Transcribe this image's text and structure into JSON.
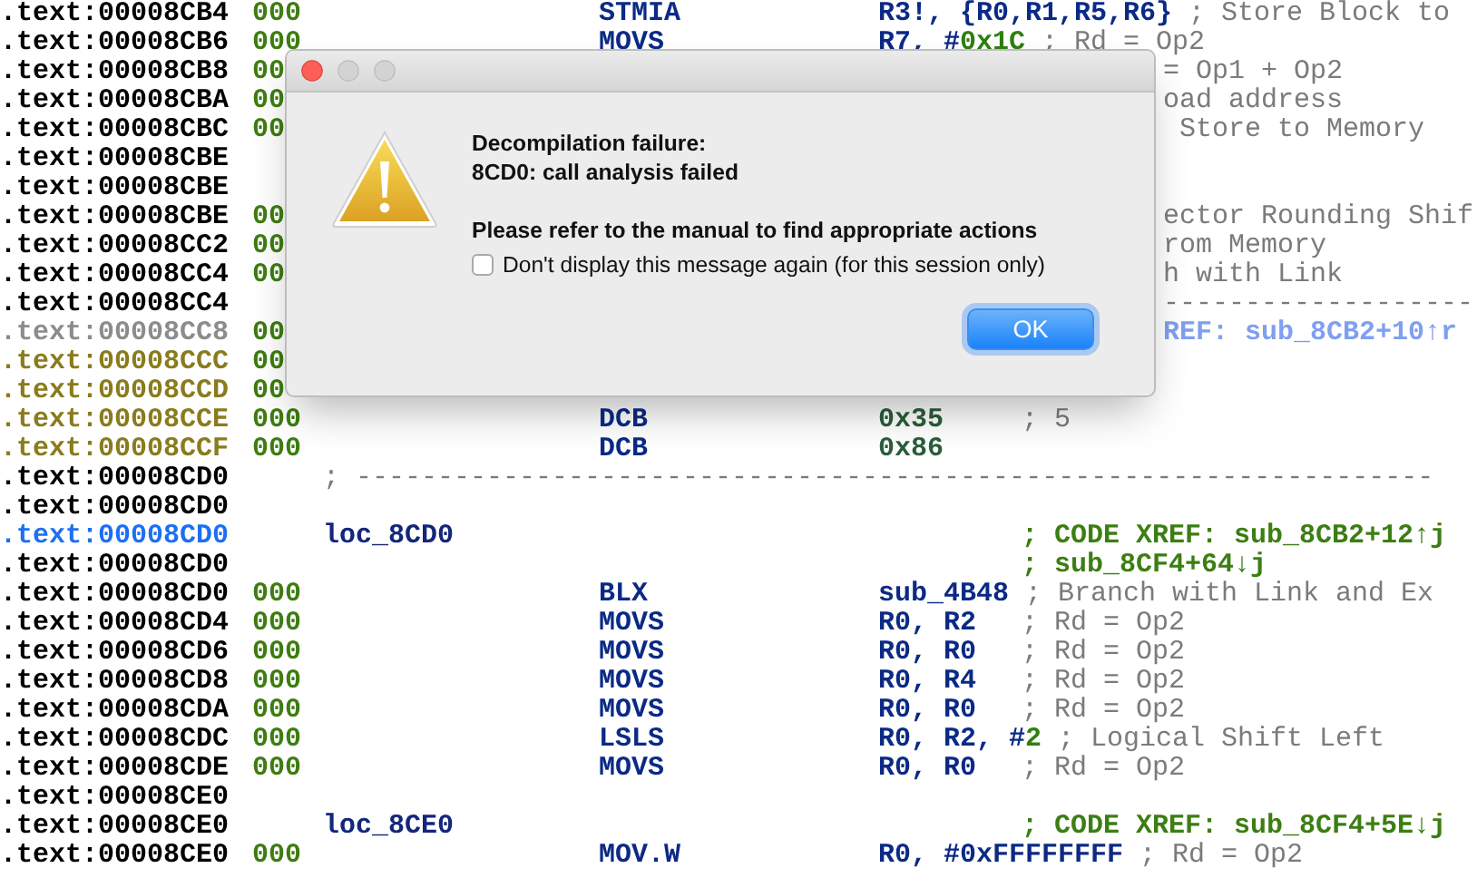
{
  "listing": {
    "rows": [
      {
        "address": {
          "text": ".text:00008CB4",
          "kind": "plain"
        },
        "bytes": "000",
        "mnemonic": "STMIA",
        "operands": [
          {
            "text": "R3!, {R0,R1,R5,R6}",
            "kind": "reg"
          }
        ],
        "comment": {
          "text": "; Store Block to",
          "kind": "note"
        }
      },
      {
        "address": {
          "text": ".text:00008CB6",
          "kind": "plain"
        },
        "bytes": "000",
        "mnemonic": "MOVS",
        "operands": [
          {
            "text": "R7, #",
            "kind": "reg"
          },
          {
            "text": "0x1C",
            "kind": "num"
          }
        ],
        "comment": {
          "text": "; Rd = Op2",
          "kind": "note"
        }
      },
      {
        "address": {
          "text": ".text:00008CB8",
          "kind": "plain"
        },
        "bytes": "00",
        "tail": {
          "text": "= Op1 + Op2",
          "kind": "note"
        }
      },
      {
        "address": {
          "text": ".text:00008CBA",
          "kind": "plain"
        },
        "bytes": "00",
        "tail": {
          "text": "oad address",
          "kind": "note"
        }
      },
      {
        "address": {
          "text": ".text:00008CBC",
          "kind": "plain"
        },
        "bytes": "00",
        "tail": {
          "text": " Store to Memory",
          "kind": "note"
        }
      },
      {
        "address": {
          "text": ".text:00008CBE",
          "kind": "plain"
        }
      },
      {
        "address": {
          "text": ".text:00008CBE",
          "kind": "plain"
        }
      },
      {
        "address": {
          "text": ".text:00008CBE",
          "kind": "plain"
        },
        "bytes": "00",
        "tail": {
          "text": "ector Rounding Shif",
          "kind": "note"
        }
      },
      {
        "address": {
          "text": ".text:00008CC2",
          "kind": "plain"
        },
        "bytes": "00",
        "tail": {
          "text": "rom Memory",
          "kind": "note"
        }
      },
      {
        "address": {
          "text": ".text:00008CC4",
          "kind": "plain"
        },
        "bytes": "00",
        "tail": {
          "text": "h with Link",
          "kind": "note"
        }
      },
      {
        "address": {
          "text": ".text:00008CC4",
          "kind": "plain"
        },
        "tail": {
          "text": "-------------------",
          "kind": "separator"
        }
      },
      {
        "address": {
          "text": ".text:00008CC8",
          "kind": "unexplored"
        },
        "bytes": "00",
        "tail": {
          "text": "REF: sub_8CB2+10↑r",
          "kind": "xref_link"
        }
      },
      {
        "address": {
          "text": ".text:00008CCC",
          "kind": "data"
        },
        "bytes": "00"
      },
      {
        "address": {
          "text": ".text:00008CCD",
          "kind": "data"
        },
        "bytes": "00"
      },
      {
        "address": {
          "text": ".text:00008CCE",
          "kind": "data"
        },
        "bytes": "000",
        "mnemonic": "DCB",
        "operands": [
          {
            "text": "0x35",
            "kind": "dat"
          }
        ],
        "comment": {
          "text": "; 5",
          "kind": "note"
        }
      },
      {
        "address": {
          "text": ".text:00008CCF",
          "kind": "data"
        },
        "bytes": "000",
        "mnemonic": "DCB",
        "operands": [
          {
            "text": "0x86",
            "kind": "dat"
          }
        ]
      },
      {
        "address": {
          "text": ".text:00008CD0",
          "kind": "plain"
        },
        "separator": "; ------------------------------------------------------------------"
      },
      {
        "address": {
          "text": ".text:00008CD0",
          "kind": "plain"
        }
      },
      {
        "address": {
          "text": ".text:00008CD0",
          "kind": "current"
        },
        "label": "loc_8CD0",
        "comment": {
          "text": "; CODE XREF: sub_8CB2+12↑j",
          "kind": "xref"
        }
      },
      {
        "address": {
          "text": ".text:00008CD0",
          "kind": "plain"
        },
        "comment": {
          "text": "; sub_8CF4+64↓j",
          "kind": "xref"
        }
      },
      {
        "address": {
          "text": ".text:00008CD0",
          "kind": "plain"
        },
        "bytes": "000",
        "mnemonic": "BLX",
        "operands": [
          {
            "text": "sub_4B48",
            "kind": "reg"
          }
        ],
        "comment": {
          "text": "; Branch with Link and Ex",
          "kind": "note"
        }
      },
      {
        "address": {
          "text": ".text:00008CD4",
          "kind": "plain"
        },
        "bytes": "000",
        "mnemonic": "MOVS",
        "operands": [
          {
            "text": "R0, R2",
            "kind": "reg"
          }
        ],
        "comment": {
          "text": "; Rd = Op2",
          "kind": "note"
        }
      },
      {
        "address": {
          "text": ".text:00008CD6",
          "kind": "plain"
        },
        "bytes": "000",
        "mnemonic": "MOVS",
        "operands": [
          {
            "text": "R0, R0",
            "kind": "reg"
          }
        ],
        "comment": {
          "text": "; Rd = Op2",
          "kind": "note"
        }
      },
      {
        "address": {
          "text": ".text:00008CD8",
          "kind": "plain"
        },
        "bytes": "000",
        "mnemonic": "MOVS",
        "operands": [
          {
            "text": "R0, R4",
            "kind": "reg"
          }
        ],
        "comment": {
          "text": "; Rd = Op2",
          "kind": "note"
        }
      },
      {
        "address": {
          "text": ".text:00008CDA",
          "kind": "plain"
        },
        "bytes": "000",
        "mnemonic": "MOVS",
        "operands": [
          {
            "text": "R0, R0",
            "kind": "reg"
          }
        ],
        "comment": {
          "text": "; Rd = Op2",
          "kind": "note"
        }
      },
      {
        "address": {
          "text": ".text:00008CDC",
          "kind": "plain"
        },
        "bytes": "000",
        "mnemonic": "LSLS",
        "operands": [
          {
            "text": "R0, R2, #",
            "kind": "reg"
          },
          {
            "text": "2",
            "kind": "num"
          }
        ],
        "comment": {
          "text": "; Logical Shift Left",
          "kind": "note"
        }
      },
      {
        "address": {
          "text": ".text:00008CDE",
          "kind": "plain"
        },
        "bytes": "000",
        "mnemonic": "MOVS",
        "operands": [
          {
            "text": "R0, R0",
            "kind": "reg"
          }
        ],
        "comment": {
          "text": "; Rd = Op2",
          "kind": "note"
        }
      },
      {
        "address": {
          "text": ".text:00008CE0",
          "kind": "plain"
        }
      },
      {
        "address": {
          "text": ".text:00008CE0",
          "kind": "plain"
        },
        "label": "loc_8CE0",
        "comment": {
          "text": "; CODE XREF: sub_8CF4+5E↓j",
          "kind": "xref"
        }
      },
      {
        "address": {
          "text": ".text:00008CE0",
          "kind": "plain"
        },
        "bytes": "000",
        "mnemonic": "MOV.W",
        "operands": [
          {
            "text": "R0, #0xFFFFFFFF",
            "kind": "reg"
          }
        ],
        "comment": {
          "text": "; Rd = Op2",
          "kind": "note"
        }
      }
    ]
  },
  "dialog": {
    "heading": [
      "Decompilation failure:",
      "8CD0: call analysis failed"
    ],
    "instruction": "Please refer to the manual to find appropriate actions",
    "checkbox": {
      "label": "Don't display this message again (for this session only)",
      "checked": false
    },
    "button": {
      "label": "OK",
      "default": true
    }
  }
}
